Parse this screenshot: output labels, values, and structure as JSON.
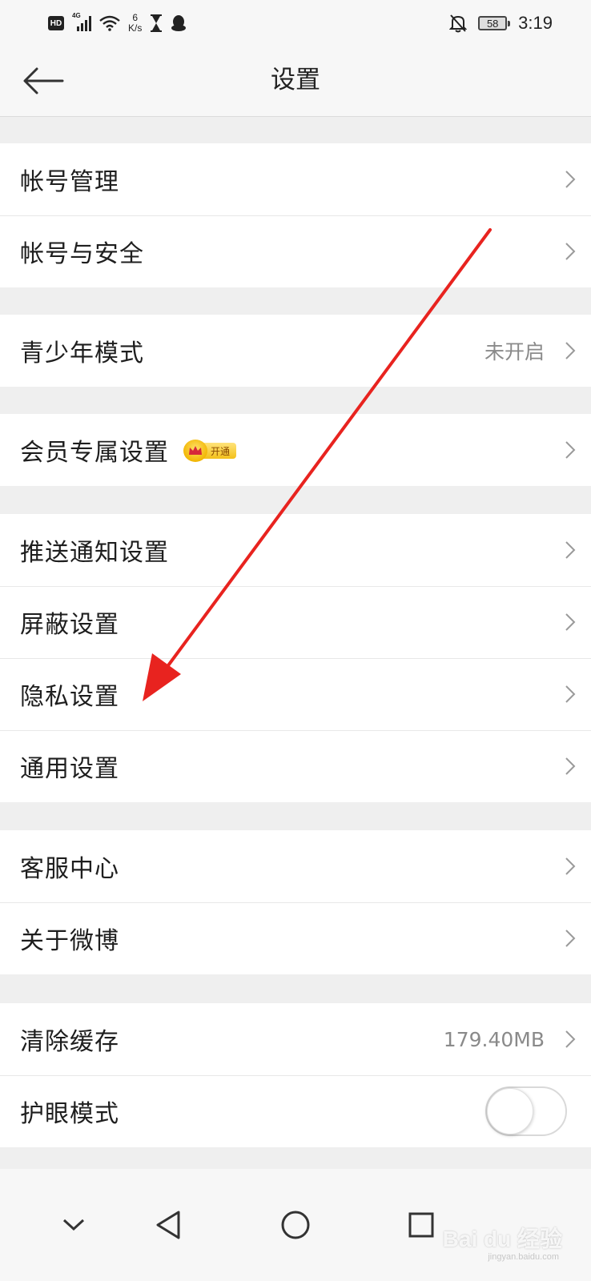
{
  "status_bar": {
    "hd": "HD",
    "network": "4G",
    "speed_value": "6",
    "speed_unit": "K/s",
    "battery": "58",
    "time": "3:19"
  },
  "header": {
    "title": "设置",
    "back_icon": "arrow-left-icon"
  },
  "groups": [
    {
      "items": [
        {
          "label": "帐号管理"
        },
        {
          "label": "帐号与安全"
        }
      ]
    },
    {
      "items": [
        {
          "label": "青少年模式",
          "value": "未开启"
        }
      ]
    },
    {
      "items": [
        {
          "label": "会员专属设置",
          "badge": "开通"
        }
      ]
    },
    {
      "items": [
        {
          "label": "推送通知设置"
        },
        {
          "label": "屏蔽设置"
        },
        {
          "label": "隐私设置"
        },
        {
          "label": "通用设置"
        }
      ]
    },
    {
      "items": [
        {
          "label": "客服中心"
        },
        {
          "label": "关于微博"
        }
      ]
    },
    {
      "items": [
        {
          "label": "清除缓存",
          "value": "179.40MB"
        },
        {
          "label": "护眼模式",
          "toggle": false
        }
      ]
    }
  ],
  "system_nav": [
    "chevron-down-icon",
    "back-triangle-icon",
    "home-circle-icon",
    "recents-square-icon"
  ],
  "watermark": {
    "text": "Bai du 经验",
    "sub": "jingyan.baidu.com"
  },
  "annotation": {
    "color": "#e8231f",
    "points_to": "隐私设置"
  }
}
